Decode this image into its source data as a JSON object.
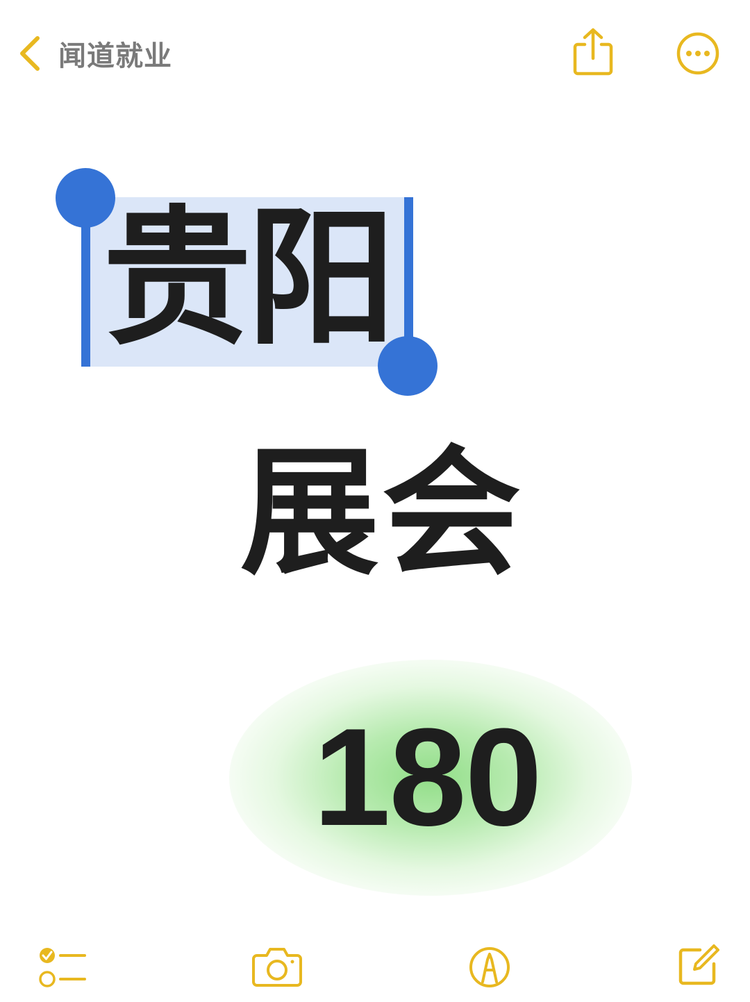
{
  "header": {
    "back_label": "闻道就业",
    "back_icon": "chevron-left-icon",
    "share_icon": "share-icon",
    "more_icon": "more-icon"
  },
  "note": {
    "selected_text": "贵阳",
    "subtitle": "展会",
    "number": "180"
  },
  "toolbar": {
    "checklist_icon": "checklist-icon",
    "camera_icon": "camera-icon",
    "markup_icon": "markup-icon",
    "compose_icon": "compose-icon"
  },
  "colors": {
    "accent": "#e8b820",
    "selection_handle": "#3573d6",
    "selection_fill": "#dbe6f8",
    "glow": "#8fdc85",
    "text": "#1e1e1e"
  }
}
